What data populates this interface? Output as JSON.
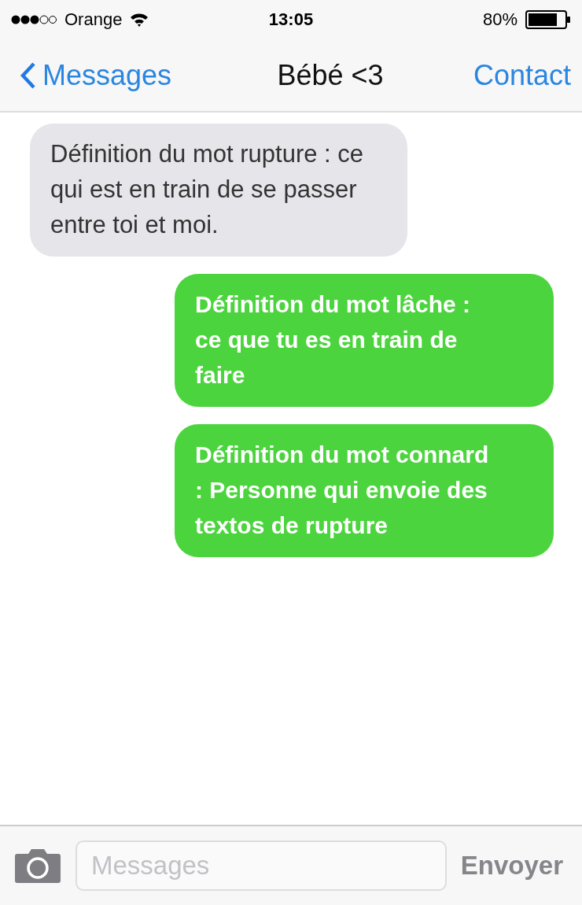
{
  "status_bar": {
    "carrier": "Orange",
    "time": "13:05",
    "battery": "80%"
  },
  "nav": {
    "back": "Messages",
    "title": "Bébé <3",
    "action": "Contact"
  },
  "messages": [
    {
      "kind": "received",
      "text": "Définition du mot rupture : ce qui est en train de se passer entre toi et moi."
    },
    {
      "kind": "sent",
      "text": "Définition du mot lâche : ce que tu es en train de faire"
    },
    {
      "kind": "sent",
      "text": "Définition du mot connard : Personne qui envoie des textos de rupture"
    }
  ],
  "composer": {
    "placeholder": "Messages",
    "send": "Envoyer"
  }
}
